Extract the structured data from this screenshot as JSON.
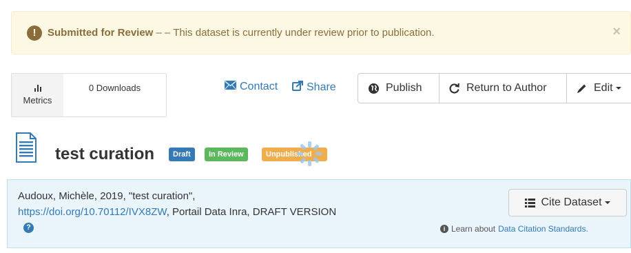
{
  "alert": {
    "title": "Submitted for Review",
    "separator": "– –",
    "message": "This dataset is currently under review prior to publication.",
    "close": "×"
  },
  "metrics": {
    "label": "Metrics",
    "downloads": "0 Downloads"
  },
  "links": {
    "contact": "Contact",
    "share": "Share"
  },
  "actions": {
    "publish": "Publish",
    "return_to_author": "Return to Author",
    "edit": "Edit"
  },
  "dataset": {
    "title": "test curation",
    "badges": {
      "draft": "Draft",
      "in_review": "In Review",
      "unpublished": "Unpublished"
    }
  },
  "citation": {
    "text_before": "Audoux, Michèle, 2019, \"test curation\",",
    "doi": "https://doi.org/10.70112/IVX8ZW",
    "text_after": ", Portail Data Inra, DRAFT VERSION",
    "help": "?",
    "cite_button": "Cite Dataset",
    "learn_prefix": "Learn about",
    "learn_link": "Data Citation Standards."
  },
  "colors": {
    "primary": "#337ab7",
    "success": "#5cb85c",
    "warning": "#f0ad4e",
    "alert_bg": "#fcf8e3",
    "alert_text": "#8a6d3b",
    "cite_bg": "#e9f4fb"
  },
  "icons": {
    "alert": "exclamation-circle-icon",
    "metrics": "bar-chart-icon",
    "contact": "envelope-icon",
    "share": "share-icon",
    "publish": "globe-icon",
    "return": "refresh-icon",
    "edit": "pencil-icon",
    "dataset": "document-icon",
    "cite": "list-icon",
    "help": "question-circle-icon",
    "info": "info-circle-icon"
  }
}
